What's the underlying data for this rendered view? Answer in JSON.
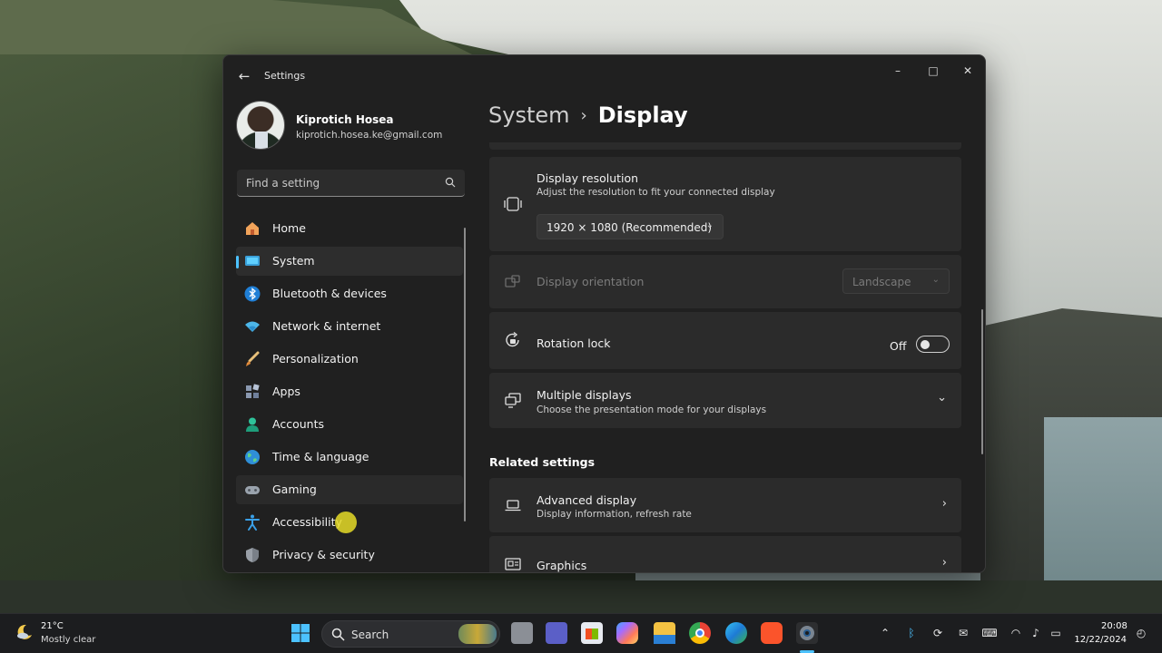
{
  "window": {
    "title": "Settings",
    "controls": {
      "minimize": "–",
      "maximize": "□",
      "close": "✕"
    }
  },
  "profile": {
    "name": "Kiprotich Hosea",
    "email": "kiprotich.hosea.ke@gmail.com"
  },
  "search": {
    "placeholder": "Find a setting"
  },
  "nav": {
    "items": [
      {
        "label": "Home",
        "icon": "home-icon"
      },
      {
        "label": "System",
        "icon": "system-icon",
        "selected": true
      },
      {
        "label": "Bluetooth & devices",
        "icon": "bluetooth-icon"
      },
      {
        "label": "Network & internet",
        "icon": "wifi-icon"
      },
      {
        "label": "Personalization",
        "icon": "brush-icon"
      },
      {
        "label": "Apps",
        "icon": "apps-icon"
      },
      {
        "label": "Accounts",
        "icon": "accounts-icon"
      },
      {
        "label": "Time & language",
        "icon": "globe-icon"
      },
      {
        "label": "Gaming",
        "icon": "controller-icon"
      },
      {
        "label": "Accessibility",
        "icon": "accessibility-icon"
      },
      {
        "label": "Privacy & security",
        "icon": "shield-icon"
      }
    ]
  },
  "breadcrumb": {
    "parent": "System",
    "separator": "›",
    "current": "Display"
  },
  "display": {
    "resolution": {
      "title": "Display resolution",
      "subtitle": "Adjust the resolution to fit your connected display",
      "value": "1920 × 1080 (Recommended)"
    },
    "orientation": {
      "title": "Display orientation",
      "value": "Landscape"
    },
    "rotation_lock": {
      "title": "Rotation lock",
      "state": "Off"
    },
    "multiple": {
      "title": "Multiple displays",
      "subtitle": "Choose the presentation mode for your displays"
    }
  },
  "related": {
    "heading": "Related settings",
    "items": [
      {
        "title": "Advanced display",
        "subtitle": "Display information, refresh rate"
      },
      {
        "title": "Graphics",
        "subtitle": ""
      }
    ]
  },
  "taskbar": {
    "weather": {
      "temp": "21°C",
      "condition": "Mostly clear"
    },
    "search_label": "Search",
    "clock": {
      "time": "20:08",
      "date": "12/22/2024"
    }
  },
  "colors": {
    "accent": "#4cc2ff",
    "window_bg": "#202020",
    "card_bg": "#2b2b2b"
  }
}
